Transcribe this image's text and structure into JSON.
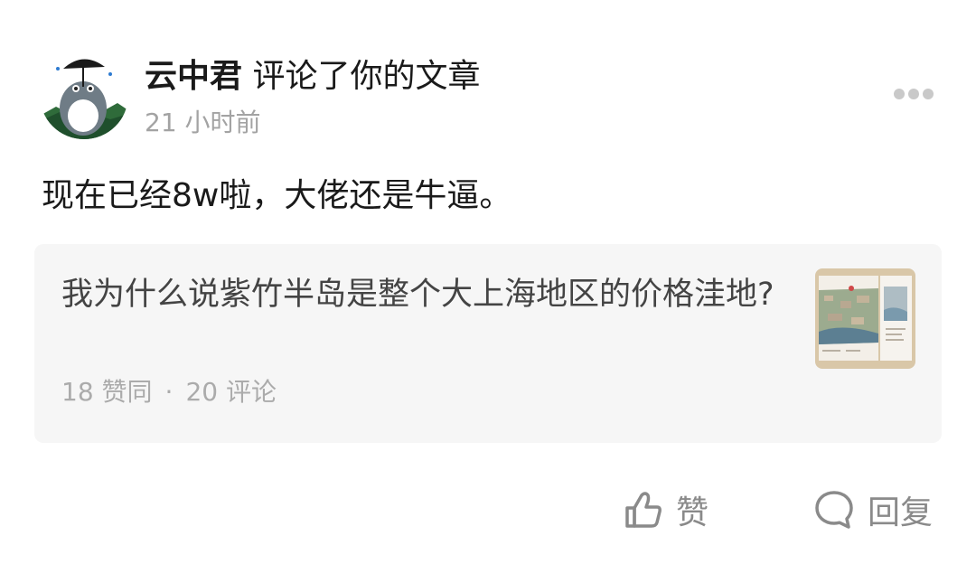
{
  "notification": {
    "user_name": "云中君",
    "action_text": "评论了你的文章",
    "timestamp": "21 小时前",
    "more_icon": "more-dots-icon",
    "comment_text": "现在已经8w啦，大佬还是牛逼。"
  },
  "article": {
    "title": "我为什么说紫竹半岛是整个大上海地区的价格洼地?",
    "likes": "18 赞同",
    "separator": "·",
    "comments": "20 评论"
  },
  "actions": {
    "like_label": "赞",
    "like_icon": "thumbs-up-icon",
    "reply_label": "回复",
    "reply_icon": "speech-bubble-icon"
  },
  "colors": {
    "text_primary": "#1a1a1a",
    "text_secondary": "#a3a3a3",
    "card_background": "#f6f6f6",
    "action_gray": "#8a8a8a"
  }
}
